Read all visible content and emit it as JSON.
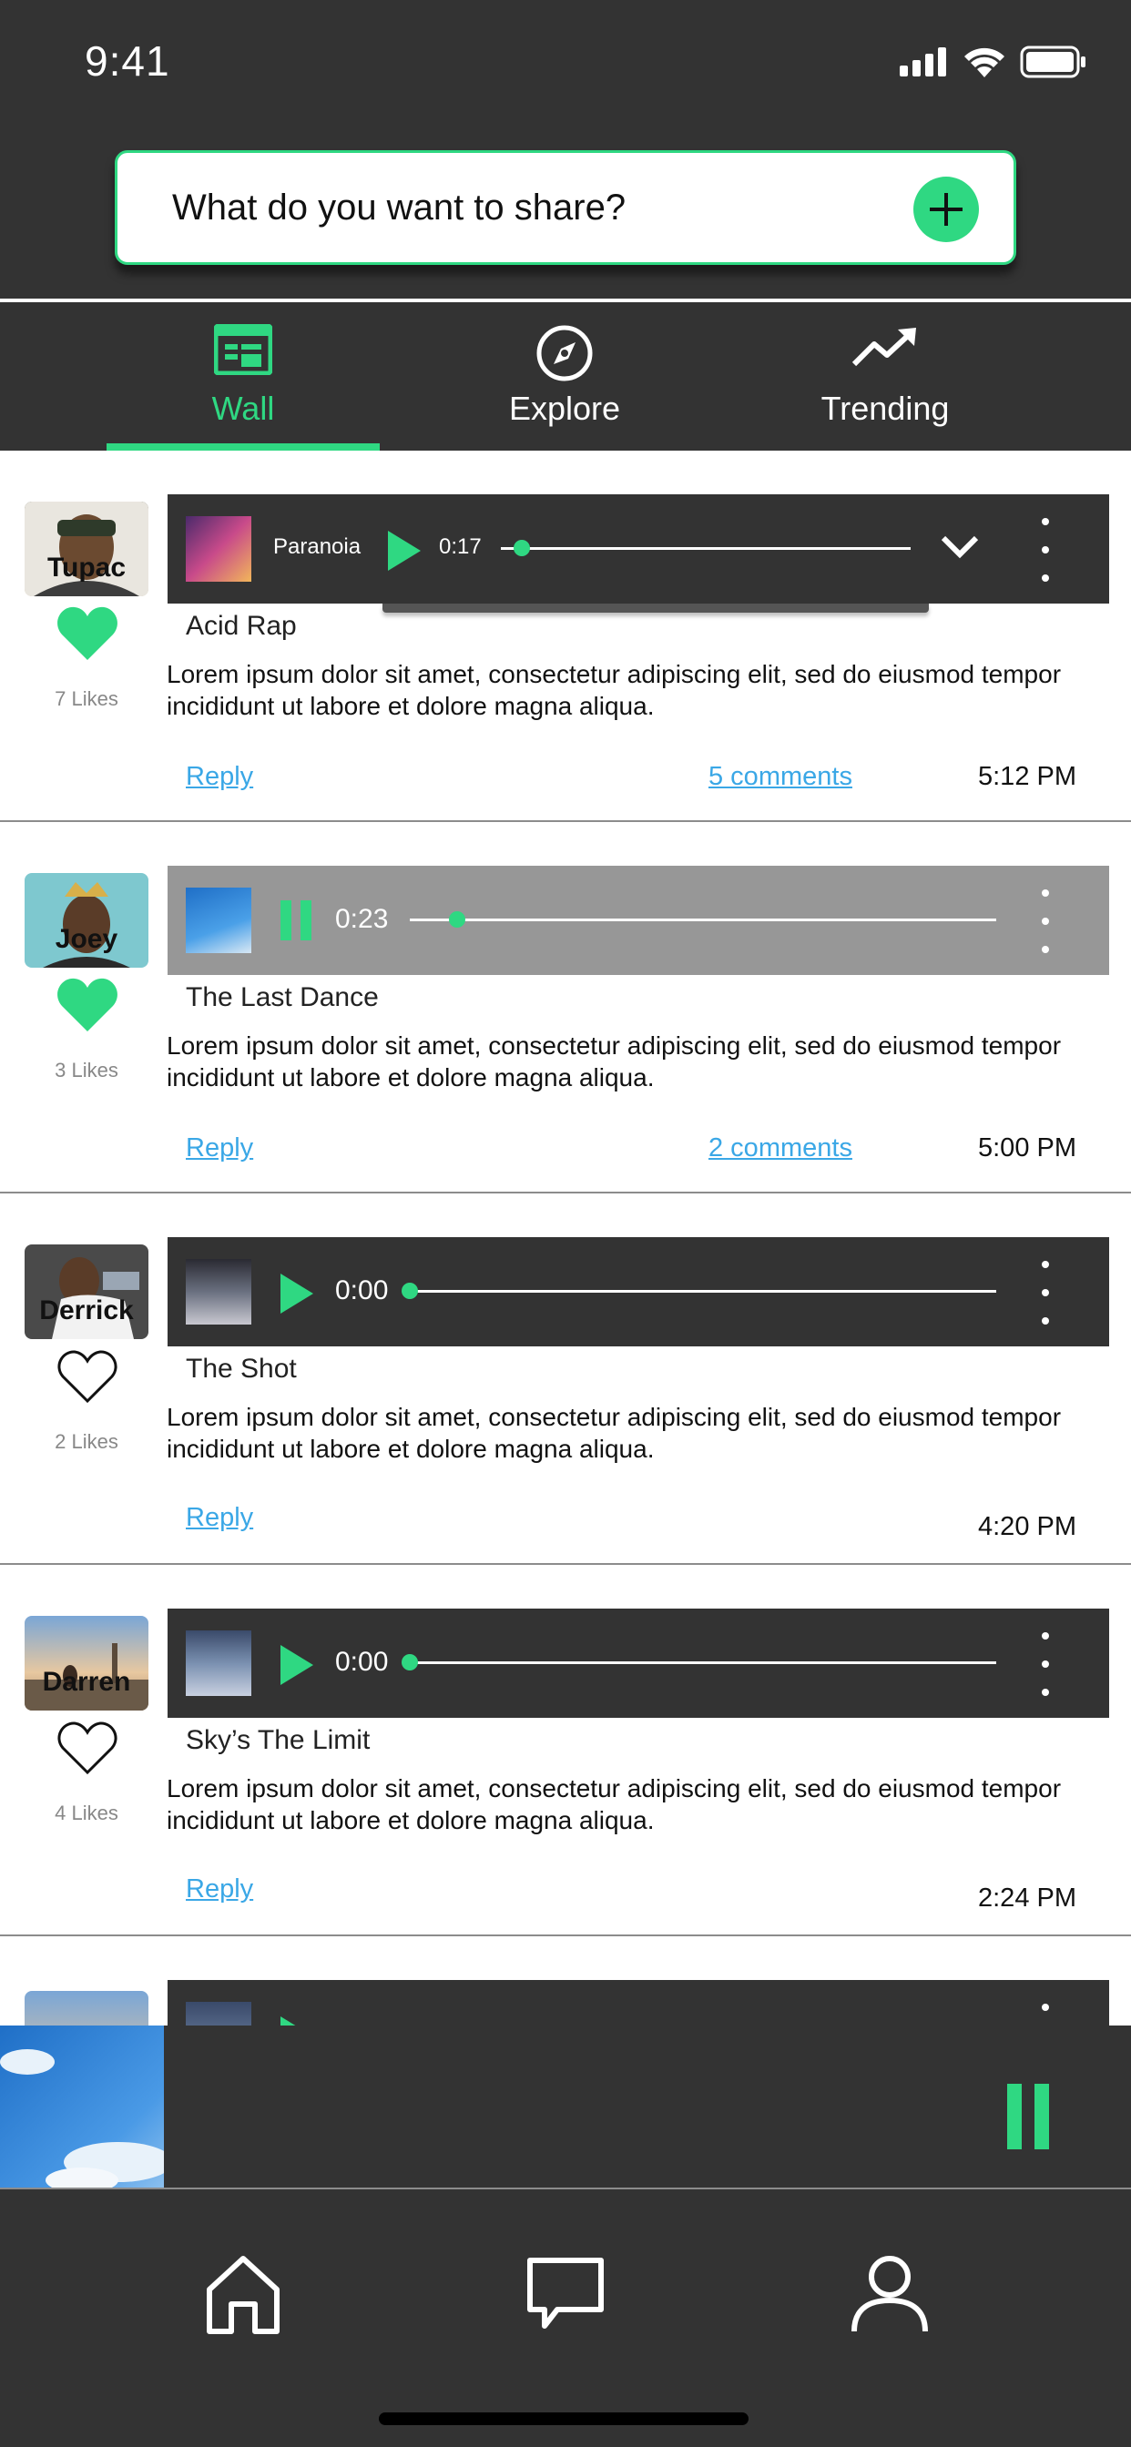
{
  "status_bar": {
    "time": "9:41"
  },
  "share": {
    "prompt": "What do you want to share?"
  },
  "tabs": [
    {
      "label": "Wall",
      "active": true
    },
    {
      "label": "Explore",
      "active": false
    },
    {
      "label": "Trending",
      "active": false
    }
  ],
  "posts": [
    {
      "user": "Tupac",
      "likes": "7 Likes",
      "liked": true,
      "player": {
        "track_name": "Paranoia",
        "elapsed": "0:17",
        "progress": 0.05,
        "state": "paused"
      },
      "title": "Acid Rap",
      "body": "Lorem ipsum dolor sit amet, consectetur adipiscing elit, sed do eiusmod tempor incididunt ut labore et dolore magna aliqua.",
      "reply": "Reply",
      "comments": "5 comments",
      "time": "5:12 PM"
    },
    {
      "user": "Joey",
      "likes": "3 Likes",
      "liked": true,
      "player": {
        "elapsed": "0:23",
        "progress": 0.08,
        "state": "playing"
      },
      "title": "The Last Dance",
      "body": "Lorem ipsum dolor sit amet, consectetur adipiscing elit, sed do eiusmod tempor incididunt ut labore et dolore magna aliqua.",
      "reply": "Reply",
      "comments": "2 comments",
      "time": "5:00 PM"
    },
    {
      "user": "Derrick",
      "likes": "2 Likes",
      "liked": false,
      "player": {
        "elapsed": "0:00",
        "progress": 0,
        "state": "paused"
      },
      "title": "The Shot",
      "body": "Lorem ipsum dolor sit amet, consectetur adipiscing elit, sed do eiusmod tempor incididunt ut labore et dolore magna aliqua.",
      "reply": "Reply",
      "comments": "",
      "time": "4:20 PM"
    },
    {
      "user": "Darren",
      "likes": "4 Likes",
      "liked": false,
      "player": {
        "elapsed": "0:00",
        "progress": 0,
        "state": "paused"
      },
      "title": "Sky’s The Limit",
      "body": "Lorem ipsum dolor sit amet, consectetur adipiscing elit, sed do eiusmod tempor incididunt ut labore et dolore magna aliqua.",
      "reply": "Reply",
      "comments": "",
      "time": "2:24 PM"
    }
  ],
  "mini_player": {
    "state": "playing"
  },
  "bottom_nav": [
    "home-icon",
    "chat-icon",
    "profile-icon"
  ],
  "colors": {
    "accent": "#2fd882",
    "bar": "#333333",
    "link": "#3aa7e6"
  }
}
